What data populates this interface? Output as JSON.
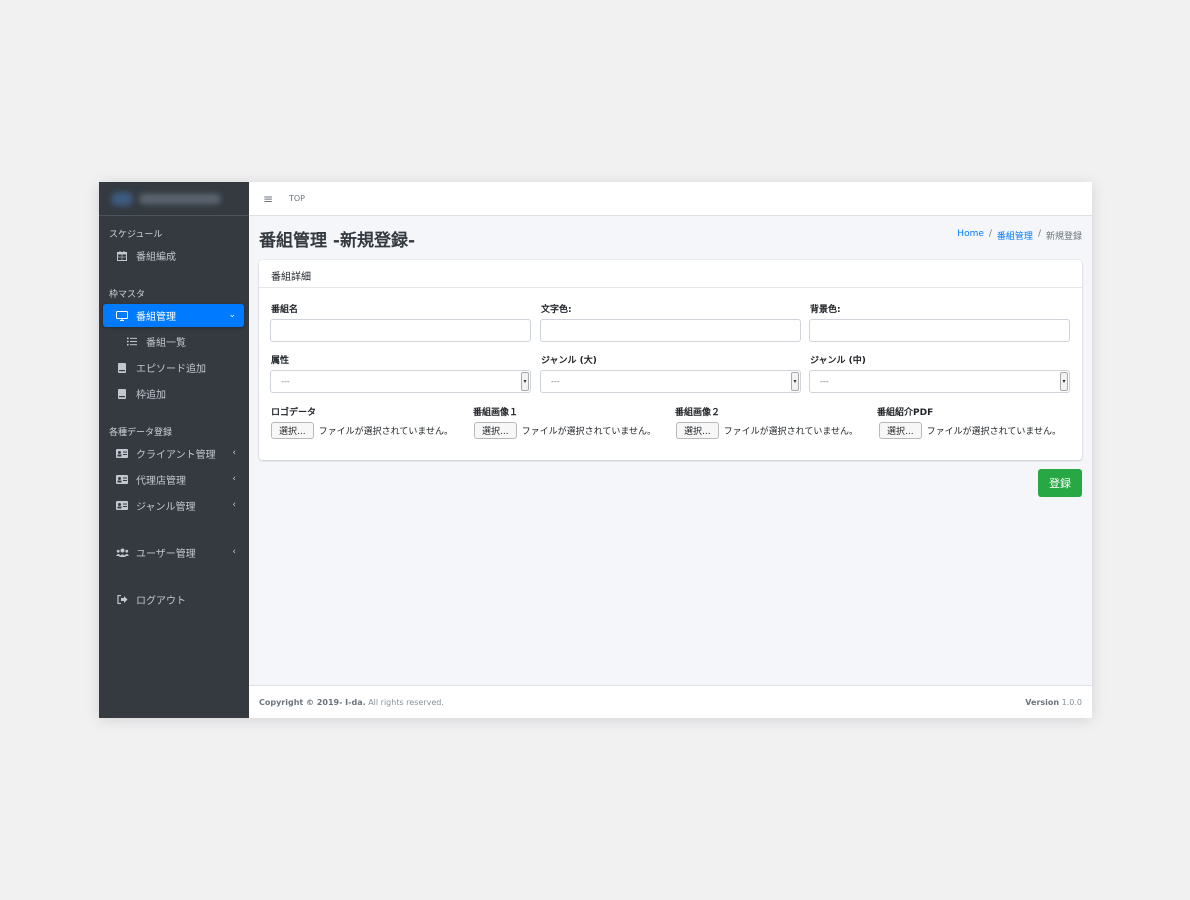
{
  "sidebar": {
    "headers": [
      "スケジュール",
      "枠マスタ",
      "各種データ登録"
    ],
    "items": [
      {
        "label": "番組編成",
        "icon": "calendar-icon"
      },
      {
        "label": "番組管理",
        "icon": "monitor-icon",
        "arrow": "⌄"
      },
      {
        "label": "番組一覧",
        "icon": "list-icon"
      },
      {
        "label": "エピソード追加",
        "icon": "book-icon"
      },
      {
        "label": "枠追加",
        "icon": "book-icon"
      },
      {
        "label": "クライアント管理",
        "icon": "id-card-icon",
        "arrow": "‹"
      },
      {
        "label": "代理店管理",
        "icon": "id-card-icon",
        "arrow": "‹"
      },
      {
        "label": "ジャンル管理",
        "icon": "id-card-icon",
        "arrow": "‹"
      },
      {
        "label": "ユーザー管理",
        "icon": "users-icon",
        "arrow": "‹"
      },
      {
        "label": "ログアウト",
        "icon": "logout-icon"
      }
    ]
  },
  "topbar": {
    "menu_icon": "≡",
    "top_link": "TOP"
  },
  "page": {
    "title": "番組管理 -新規登録-",
    "breadcrumb": {
      "home": "Home",
      "section": "番組管理",
      "sep": "/",
      "current": "新規登録"
    }
  },
  "card": {
    "title": "番組詳細",
    "fields": {
      "program_name": "番組名",
      "text_color": "文字色:",
      "bg_color": "背景色:",
      "attribute": "属性",
      "genre_large": "ジャンル (大)",
      "genre_medium": "ジャンル (中)"
    },
    "select_placeholder": "---",
    "files": [
      {
        "label": "ロゴデータ"
      },
      {
        "label": "番組画像１"
      },
      {
        "label": "番組画像２"
      },
      {
        "label": "番組紹介PDF"
      }
    ],
    "file_button": "選択...",
    "file_status": "ファイルが選択されていません。"
  },
  "submit_label": "登録",
  "footer": {
    "copyright_strong": "Copyright © 2019- I-da.",
    "copyright_rest": " All rights reserved.",
    "version_label": "Version",
    "version": " 1.0.0"
  },
  "colors": {
    "sidebar": "#343a40",
    "active": "#007bff",
    "submit": "#28a745"
  }
}
